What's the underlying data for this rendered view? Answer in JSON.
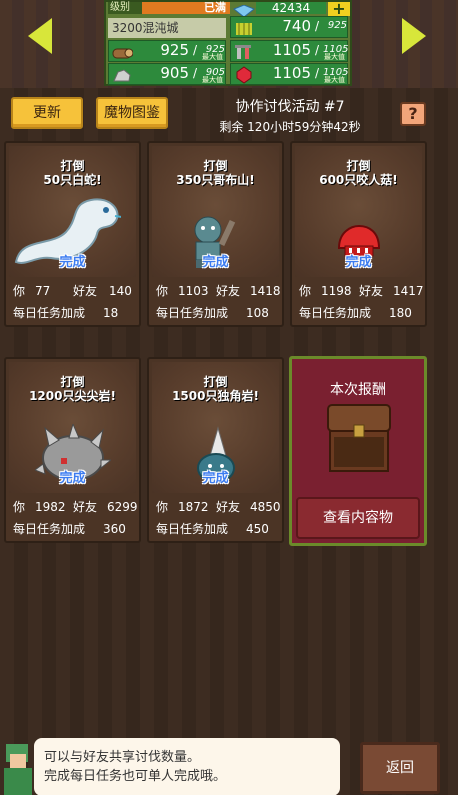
{
  "status": {
    "level_label": "级别",
    "level_value": "已满",
    "gems": "42434",
    "plus_label": "+",
    "city": "3200混沌城",
    "resources": [
      {
        "icon": "wood-icon",
        "current": "925",
        "max": "925",
        "tag": "最大值"
      },
      {
        "icon": "grass-icon",
        "current": "740",
        "max": "925",
        "tag": ""
      },
      {
        "icon": "stone-icon",
        "current": "905",
        "max": "905",
        "tag": "最大值"
      },
      {
        "icon": "tools-icon",
        "current": "1105",
        "max": "1105",
        "tag": "最大值"
      },
      {
        "icon": "ruby-icon",
        "current": "1105",
        "max": "1105",
        "tag": "最大值"
      }
    ],
    "extra_res": {
      "current": "1105",
      "max": "1105",
      "tag": "最大值"
    }
  },
  "header": {
    "update_label": "更新",
    "bestiary_label": "魔物图鉴",
    "title": "协作讨伐活动 #7",
    "remaining": "剩余 120小时59分钟42秒",
    "help_label": "?"
  },
  "labels": {
    "you": "你",
    "friends": "好友",
    "daily_bonus": "每日任务加成",
    "done": "完成"
  },
  "quests": [
    {
      "line1": "打倒",
      "line2": "50只白蛇!",
      "you": "77",
      "friends": "140",
      "bonus": "18",
      "monster": "white-serpent"
    },
    {
      "line1": "打倒",
      "line2": "350只哥布山!",
      "you": "1103",
      "friends": "1418",
      "bonus": "108",
      "monster": "goblin"
    },
    {
      "line1": "打倒",
      "line2": "600只咬人菇!",
      "you": "1198",
      "friends": "1417",
      "bonus": "180",
      "monster": "red-mushroom"
    },
    {
      "line1": "打倒",
      "line2": "1200只尖尖岩!",
      "you": "1982",
      "friends": "6299",
      "bonus": "360",
      "monster": "spiky-rock"
    },
    {
      "line1": "打倒",
      "line2": "1500只独角岩!",
      "you": "1872",
      "friends": "4850",
      "bonus": "450",
      "monster": "horn-rock"
    }
  ],
  "reward": {
    "title": "本次报酬",
    "button_label": "查看内容物"
  },
  "tip": {
    "line1": "可以与好友共享讨伐数量。",
    "line2": "完成每日任务也可单人完成哦。"
  },
  "back_label": "返回",
  "colors": {
    "accent_yellow": "#f6c23a",
    "done_blue": "#3c7cf0",
    "reward_red": "#7a2030",
    "resource_green": "#2d8a3c"
  }
}
